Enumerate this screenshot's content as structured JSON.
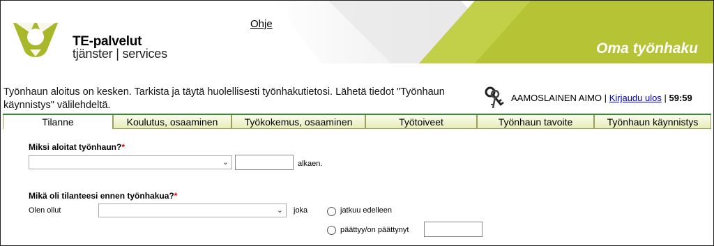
{
  "header": {
    "brand_line1": "TE-palvelut",
    "brand_line2": "tjänster | services",
    "help_link": "Ohje",
    "app_title": "Oma työnhaku",
    "accent_color": "#b5c334",
    "logo_color": "#a9b82b"
  },
  "notice": {
    "text": "Työnhaun aloitus on kesken. Tarkista ja täytä huolellisesti työnhakutietosi. Lähetä tiedot \"Työnhaun käynnistys\" välilehdeltä."
  },
  "user": {
    "name": "AAMOSLAINEN AIMO",
    "separator1": "|",
    "logout": "Kirjaudu ulos",
    "separator2": "|",
    "timer": "59:59",
    "keys_icon": "keys-icon"
  },
  "tabs": [
    {
      "label": "Tilanne"
    },
    {
      "label": "Koulutus, osaaminen"
    },
    {
      "label": "Työkokemus, osaaminen"
    },
    {
      "label": "Työtoiveet"
    },
    {
      "label": "Työnhaun tavoite"
    },
    {
      "label": "Työnhaun käynnistys"
    }
  ],
  "form": {
    "q1_label": "Miksi aloitat työnhaun?",
    "required_mark": "*",
    "q1_select_value": "",
    "q1_date_value": "",
    "q1_suffix": "alkaen.",
    "q2_label": "Mikä oli tilanteesi ennen työnhakua?",
    "q2_prefix": "Olen ollut",
    "q2_select_value": "",
    "q2_joka": "joka",
    "radio1_label": "jatkuu edelleen",
    "radio2_label": "päättyy/on päättynyt",
    "radio2_date_value": ""
  }
}
